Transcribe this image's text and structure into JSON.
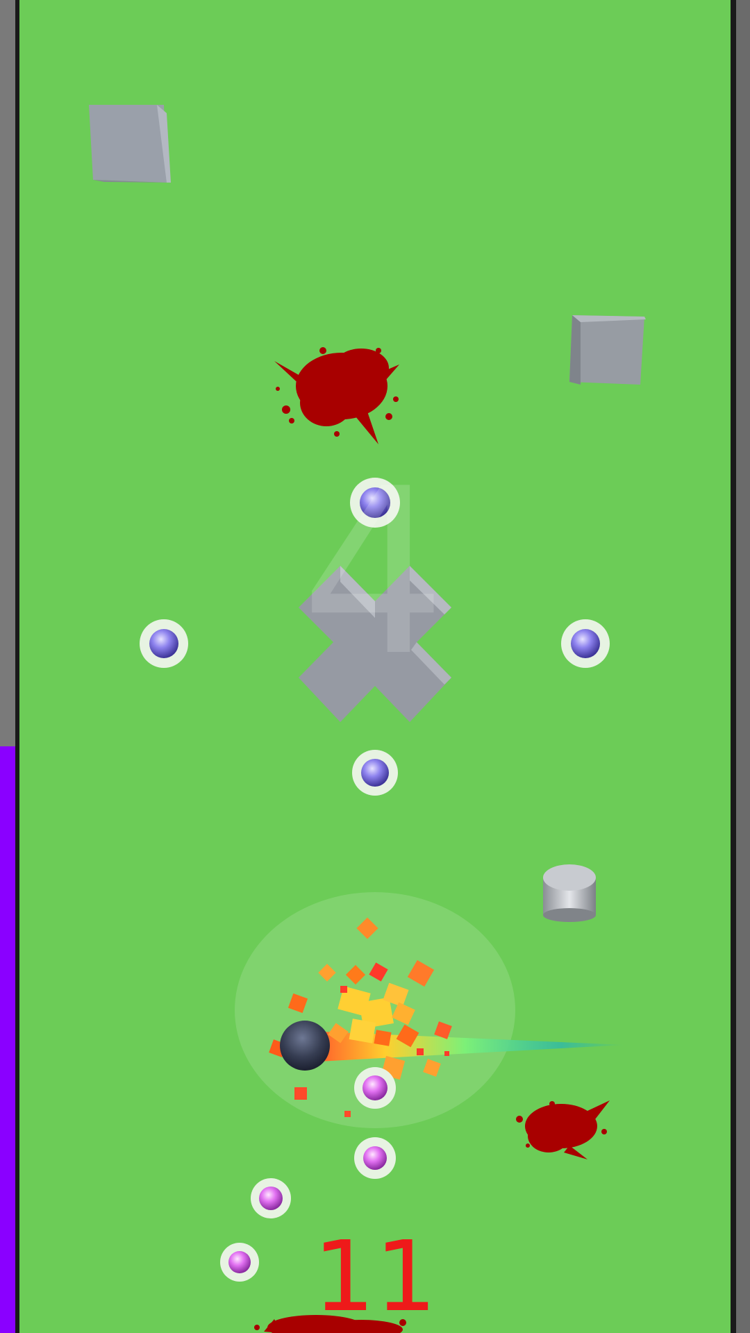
{
  "hud": {
    "score": "11",
    "countdown": "4",
    "progress_fraction": 0.44,
    "progress_color": "#8a00ff"
  },
  "colors": {
    "ground": "#6ccc57",
    "obstacle": "#9aa0a8",
    "splatter": "#a80000",
    "blue_orb": "#7f74e6",
    "pink_orb": "#e070f0",
    "player_ball": "#3a4256",
    "score_text": "#ee1a1a"
  },
  "objects": {
    "blue_orbs": 4,
    "pink_orbs": 4,
    "cubes": 2,
    "cylinders": 1,
    "splatters": 3
  }
}
